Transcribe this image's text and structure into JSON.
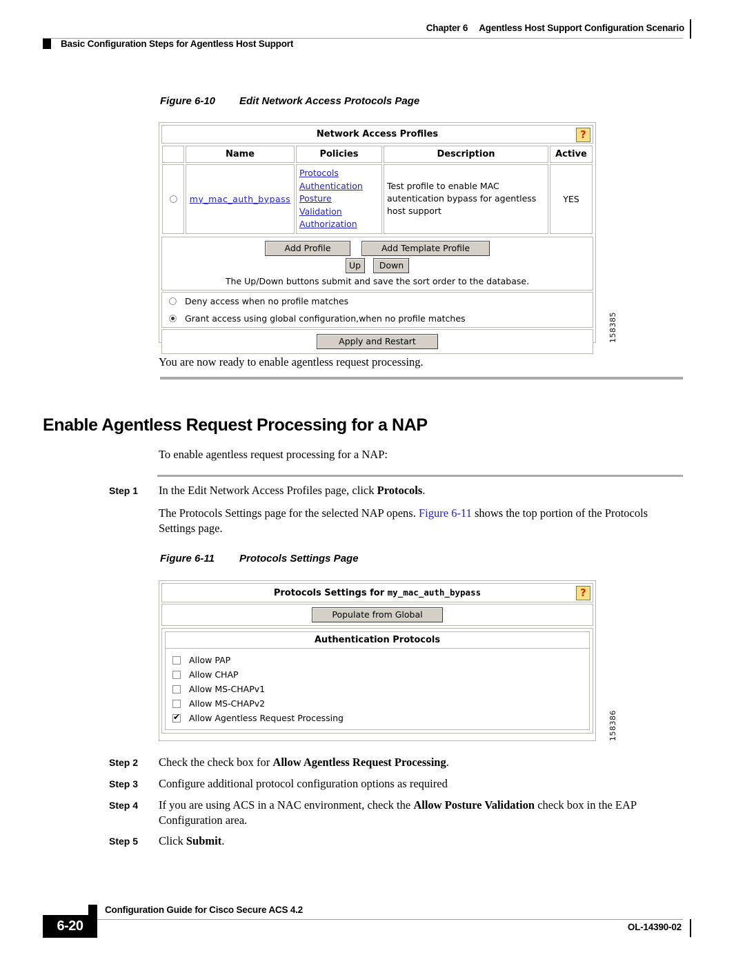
{
  "header": {
    "chapter_label": "Chapter 6",
    "chapter_title": "Agentless Host Support Configuration Scenario",
    "section_title": "Basic Configuration Steps for Agentless Host Support"
  },
  "figure_10": {
    "number": "Figure 6-10",
    "title": "Edit Network Access Protocols Page",
    "figure_id": "158385",
    "help_icon": "?",
    "panel_title": "Network Access Profiles",
    "columns": [
      "",
      "Name",
      "Policies",
      "Description",
      "Active"
    ],
    "row": {
      "name": "my_mac_auth_bypass",
      "policies": [
        "Protocols",
        "Authentication",
        "Posture",
        "Validation",
        "Authorization"
      ],
      "description": "Test profile to enable MAC autentication bypass for agentless host support",
      "active": "YES",
      "selected": false
    },
    "buttons": {
      "add_profile": "Add Profile",
      "add_template_profile": "Add Template Profile",
      "up": "Up",
      "down": "Down",
      "apply_and_restart": "Apply and Restart"
    },
    "hint": "The Up/Down buttons submit and save the sort order to the database.",
    "options": [
      {
        "label": "Deny access when no profile matches",
        "selected": false
      },
      {
        "label": "Grant access using global configuration,when no profile matches",
        "selected": true
      }
    ]
  },
  "para_ready": "You are now ready to enable agentless request processing.",
  "heading": "Enable Agentless Request Processing for a NAP",
  "intro": "To enable agentless request processing for a NAP:",
  "steps": [
    {
      "label": "Step 1",
      "line1_pre": "In the Edit Network Access Profiles page, click ",
      "line1_bold": "Protocols",
      "line1_post": ".",
      "line2_pre": "The Protocols Settings page for the selected NAP opens. ",
      "line2_xref": "Figure 6-11",
      "line2_post": " shows the top portion of the Protocols Settings page."
    },
    {
      "label": "Step 2",
      "pre": "Check the check box for ",
      "bold": "Allow Agentless Request Processing",
      "post": "."
    },
    {
      "label": "Step 3",
      "pre": "Configure additional protocol configuration options as required",
      "bold": "",
      "post": ""
    },
    {
      "label": "Step 4",
      "pre": "If you are using ACS in a NAC environment, check the ",
      "bold": "Allow Posture Validation",
      "post": " check box in the EAP Configuration area."
    },
    {
      "label": "Step 5",
      "pre": "Click ",
      "bold": "Submit",
      "post": "."
    }
  ],
  "figure_11": {
    "number": "Figure 6-11",
    "title": "Protocols Settings Page",
    "figure_id": "158386",
    "help_icon": "?",
    "panel_title_prefix": "Protocols Settings for ",
    "panel_title_profile": "my_mac_auth_bypass",
    "populate_button": "Populate from Global",
    "section_title": "Authentication Protocols",
    "checkboxes": [
      {
        "label": "Allow PAP",
        "checked": false
      },
      {
        "label": "Allow CHAP",
        "checked": false
      },
      {
        "label": "Allow MS-CHAPv1",
        "checked": false
      },
      {
        "label": "Allow MS-CHAPv2",
        "checked": false
      },
      {
        "label": "Allow Agentless Request Processing",
        "checked": true
      }
    ]
  },
  "footer": {
    "title": "Configuration Guide for Cisco Secure ACS 4.2",
    "page_number": "6-20",
    "doc_id": "OL-14390-02"
  }
}
